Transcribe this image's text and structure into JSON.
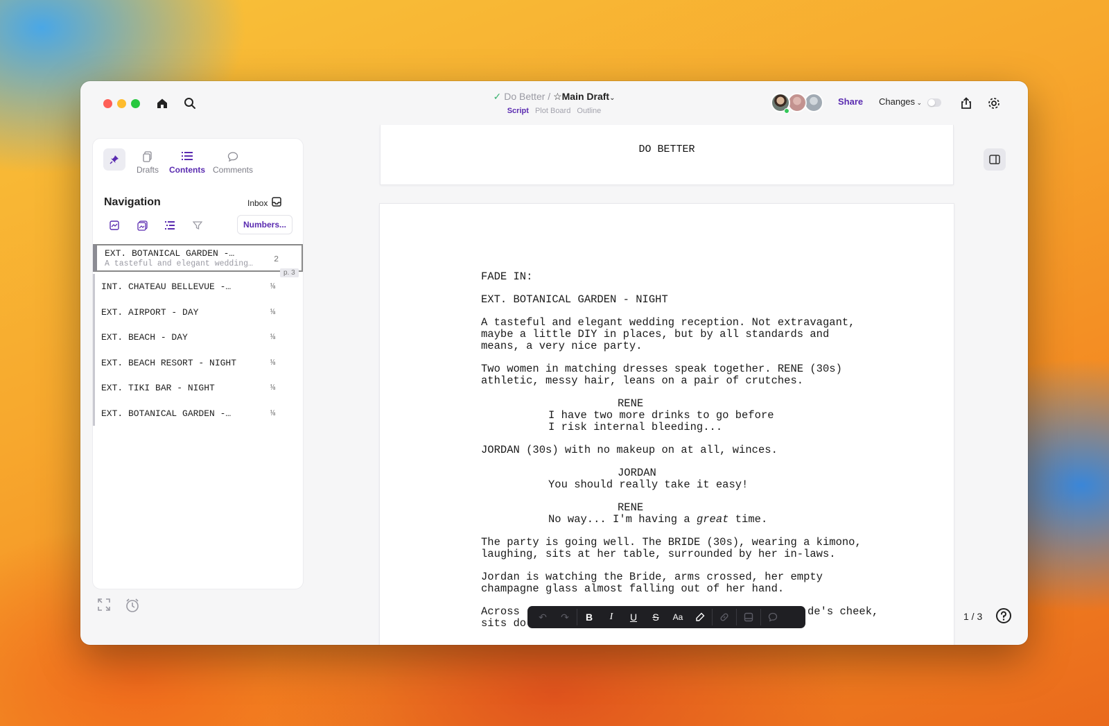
{
  "titlebar": {
    "project": "Do Better",
    "separator": "/",
    "draft": "Main Draft",
    "tabs": [
      {
        "label": "Script",
        "active": true
      },
      {
        "label": "Plot Board",
        "active": false
      },
      {
        "label": "Outline",
        "active": false
      }
    ],
    "share_label": "Share",
    "changes_label": "Changes",
    "icons": [
      "home-icon",
      "search-icon",
      "export-icon",
      "gear-icon"
    ]
  },
  "sidebar": {
    "tabs": [
      {
        "label": "Drafts",
        "icon": "drafts-icon"
      },
      {
        "label": "Contents",
        "icon": "list-icon",
        "active": true
      },
      {
        "label": "Comments",
        "icon": "comment-icon"
      }
    ],
    "title": "Navigation",
    "inbox_label": "Inbox",
    "numbers_label": "Numbers...",
    "scenes": [
      {
        "name": "EXT. BOTANICAL GARDEN -…",
        "summary": "A tasteful and elegant wedding…",
        "length": "2",
        "active": true
      },
      {
        "name": "INT. CHATEAU BELLEVUE -…",
        "length": "⅛"
      },
      {
        "name": "EXT. AIRPORT - DAY",
        "length": "⅛"
      },
      {
        "name": "EXT. BEACH - DAY",
        "length": "⅛"
      },
      {
        "name": "EXT. BEACH RESORT - NIGHT",
        "length": "⅛"
      },
      {
        "name": "EXT. TIKI BAR - NIGHT",
        "length": "⅛"
      },
      {
        "name": "EXT. BOTANICAL GARDEN -…",
        "length": "⅛"
      }
    ],
    "page_tag": "p. 3"
  },
  "editor": {
    "title_page": "DO BETTER",
    "lines": [
      "FADE IN:",
      "EXT. BOTANICAL GARDEN - NIGHT",
      "A tasteful and elegant wedding reception. Not extravagant,",
      "maybe a little DIY in places, but by all standards and",
      "means, a very nice party.",
      "Two women in matching dresses speak together. RENE (30s)",
      "athletic, messy hair, leans on a pair of crutches.",
      "RENE",
      "I have two more drinks to go before",
      "I risk internal bleeding...",
      "JORDAN (30s) with no makeup on at all, winces.",
      "JORDAN",
      "You should really take it easy!",
      "RENE",
      "No way... I'm having a ",
      "great",
      " time.",
      "The party is going well. The BRIDE (30s), wearing a kimono,",
      "laughing, sits at her table, surrounded by her in-laws.",
      "Jordan is watching the Bride, arms crossed, her empty",
      "champagne glass almost falling out of her hand.",
      "Across",
      "de's cheek,",
      "sits do"
    ],
    "page_count": "1 / 3"
  },
  "format_bar": {
    "buttons": [
      "undo",
      "redo",
      "B",
      "I",
      "U",
      "S",
      "Aa",
      "highlight",
      "link",
      "note",
      "comment"
    ]
  }
}
